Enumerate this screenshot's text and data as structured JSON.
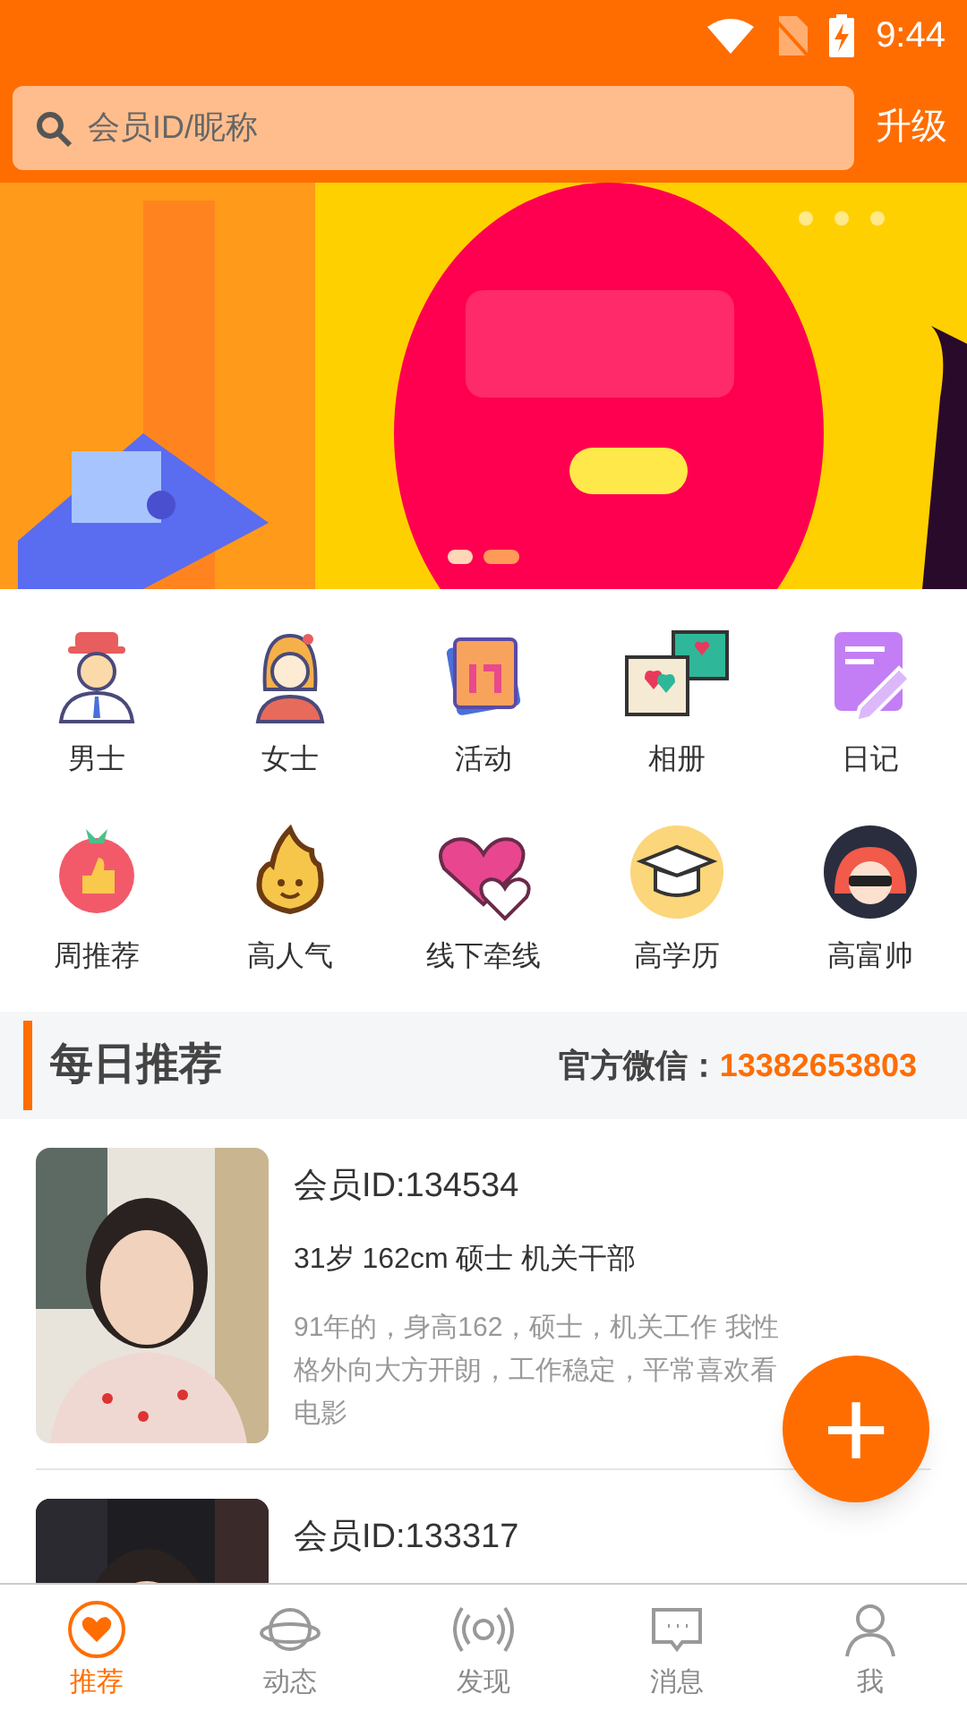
{
  "status_bar": {
    "time": "9:44"
  },
  "search": {
    "placeholder": "会员ID/昵称"
  },
  "upgrade_button": "升级",
  "banner": {
    "kind": "picture",
    "dots": [
      {
        "selected": false
      },
      {
        "selected": true
      }
    ]
  },
  "categories": [
    {
      "label": "男士",
      "kind": "man"
    },
    {
      "label": "女士",
      "kind": "woman"
    },
    {
      "label": "活动",
      "kind": "calendar"
    },
    {
      "label": "相册",
      "kind": "album"
    },
    {
      "label": "日记",
      "kind": "diary"
    },
    {
      "label": "周推荐",
      "kind": "thumb"
    },
    {
      "label": "高人气",
      "kind": "flame"
    },
    {
      "label": "线下牵线",
      "kind": "hearts"
    },
    {
      "label": "高学历",
      "kind": "cap"
    },
    {
      "label": "高富帅",
      "kind": "cool"
    }
  ],
  "section": {
    "title": "每日推荐",
    "contact_label": "官方微信：",
    "contact_value": "13382653803"
  },
  "members": [
    {
      "id": "会员ID:134534",
      "info": "31岁 162cm 硕士 机关干部",
      "description": "91年的，身高162，硕士，机关工作 我性格外向大方开朗，工作稳定，平常喜欢看电影"
    },
    {
      "id": "会员ID:133317"
    }
  ],
  "fab": {
    "symbol": "+"
  },
  "tabs": [
    {
      "label": "推荐",
      "kind": "heart",
      "selected": true
    },
    {
      "label": "动态",
      "kind": "planet",
      "selected": false
    },
    {
      "label": "发现",
      "kind": "signal",
      "selected": false
    },
    {
      "label": "消息",
      "kind": "message",
      "selected": false
    },
    {
      "label": "我",
      "kind": "person",
      "selected": false
    }
  ]
}
